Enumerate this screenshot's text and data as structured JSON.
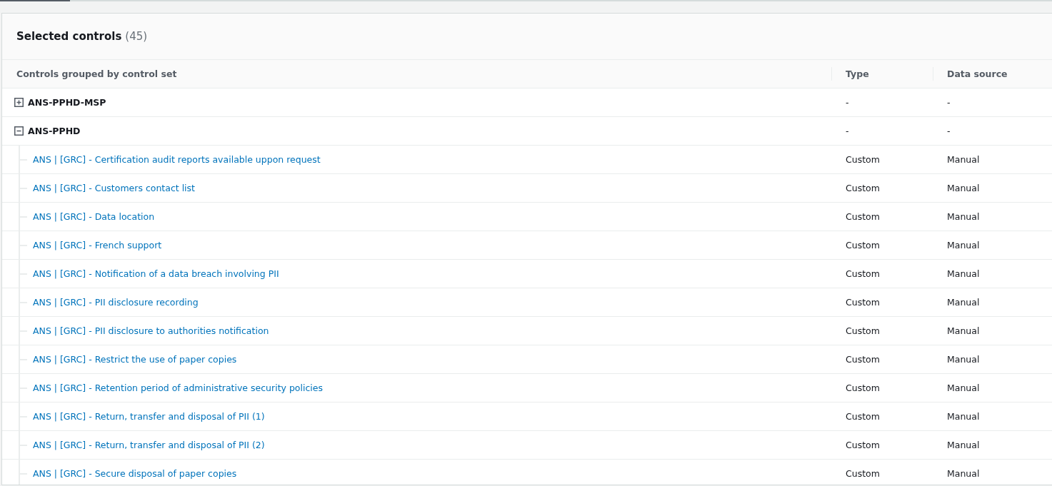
{
  "panel": {
    "title": "Selected controls",
    "count": "(45)"
  },
  "table": {
    "columns": [
      "Controls grouped by control set",
      "Type",
      "Data source"
    ],
    "groups": [
      {
        "name": "ANS-PPHD-MSP",
        "type": "-",
        "data_source": "-",
        "expanded": false
      },
      {
        "name": "ANS-PPHD",
        "type": "-",
        "data_source": "-",
        "expanded": true,
        "children": [
          {
            "name": "ANS | [GRC] - Certification audit reports available uppon request",
            "type": "Custom",
            "data_source": "Manual"
          },
          {
            "name": "ANS | [GRC] - Customers contact list",
            "type": "Custom",
            "data_source": "Manual"
          },
          {
            "name": "ANS | [GRC] - Data location",
            "type": "Custom",
            "data_source": "Manual"
          },
          {
            "name": "ANS | [GRC] - French support",
            "type": "Custom",
            "data_source": "Manual"
          },
          {
            "name": "ANS | [GRC] - Notification of a data breach involving PII",
            "type": "Custom",
            "data_source": "Manual"
          },
          {
            "name": "ANS | [GRC] - PII disclosure recording",
            "type": "Custom",
            "data_source": "Manual"
          },
          {
            "name": "ANS | [GRC] - PII disclosure to authorities notification",
            "type": "Custom",
            "data_source": "Manual"
          },
          {
            "name": "ANS | [GRC] - Restrict the use of paper copies",
            "type": "Custom",
            "data_source": "Manual"
          },
          {
            "name": "ANS | [GRC] - Retention period of administrative security policies",
            "type": "Custom",
            "data_source": "Manual"
          },
          {
            "name": "ANS | [GRC] - Return, transfer and disposal of PII (1)",
            "type": "Custom",
            "data_source": "Manual"
          },
          {
            "name": "ANS | [GRC] - Return, transfer and disposal of PII (2)",
            "type": "Custom",
            "data_source": "Manual"
          },
          {
            "name": "ANS | [GRC] - Secure disposal of paper copies",
            "type": "Custom",
            "data_source": "Manual"
          }
        ]
      }
    ]
  }
}
